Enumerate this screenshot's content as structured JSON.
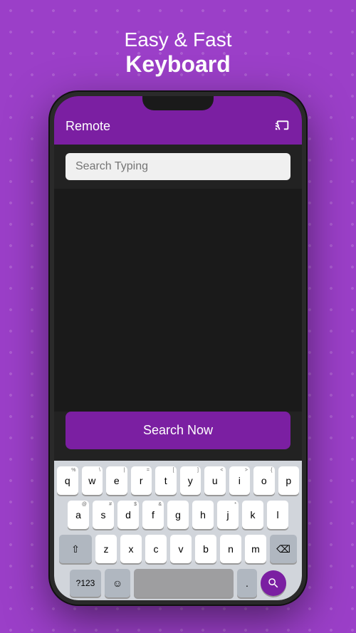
{
  "header": {
    "line1": "Easy & Fast",
    "line2": "Keyboard"
  },
  "app": {
    "title": "Remote",
    "cast_icon": "⊟"
  },
  "search": {
    "placeholder": "Search Typing",
    "button_label": "Search Now"
  },
  "keyboard": {
    "row1": [
      "q",
      "w",
      "e",
      "r",
      "t",
      "y",
      "u",
      "i",
      "o",
      "p"
    ],
    "row1_super": [
      "%",
      "\\",
      "|",
      "=",
      "[",
      "]",
      "<",
      ">",
      "{",
      ""
    ],
    "row2": [
      "a",
      "s",
      "d",
      "f",
      "g",
      "h",
      "j",
      "k",
      "l"
    ],
    "row2_super": [
      "@",
      "#",
      "$",
      "&",
      "*",
      "",
      "*",
      "",
      ""
    ],
    "row3": [
      "z",
      "x",
      "c",
      "v",
      "b",
      "n",
      "m"
    ],
    "numbers_label": "?123",
    "space_label": "",
    "period_label": "."
  }
}
